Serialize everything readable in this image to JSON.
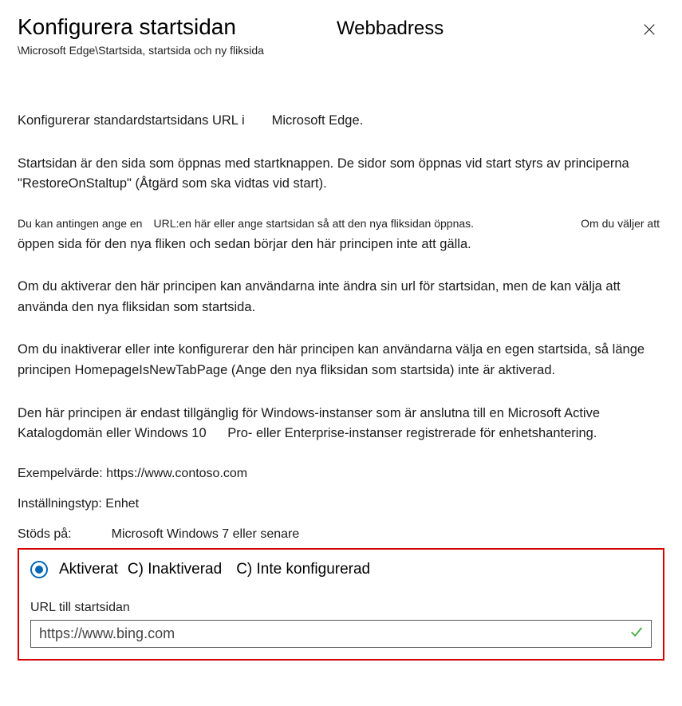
{
  "header": {
    "title": "Konfigurera startsidan",
    "subtitle": "Webbadress",
    "breadcrumb": "\\Microsoft Edge\\Startsida, startsida och ny fliksida"
  },
  "body": {
    "p1_a": "Konfigurerar standardstartsidans URL i",
    "p1_b": "Microsoft Edge.",
    "p2": "Startsidan är den sida som öppnas med startknappen. De sidor som öppnas vid start styrs av principerna \"RestoreOnStaltup\" (Åtgärd som ska vidtas vid start).",
    "p3_small_a": "Du kan antingen ange en",
    "p3_small_b": "URL:en här eller ange startsidan så att den nya fliksidan öppnas.",
    "p3_small_c": "Om du väljer att",
    "p3_line2": "öppen sida för den nya fliken och sedan börjar den här principen inte att gälla.",
    "p4": "Om du aktiverar den här principen kan användarna inte ändra sin url för startsidan, men de kan välja att använda den nya fliksidan som startsida.",
    "p5": "Om du inaktiverar eller inte konfigurerar den här principen kan användarna välja en egen startsida, så länge principen HomepageIsNewTabPage (Ange den nya fliksidan som startsida) inte är aktiverad.",
    "p6_a": "Den här principen är endast tillgänglig för Windows-instanser som är anslutna till en Microsoft Active Katalogdomän eller Windows 10",
    "p6_b": "Pro- eller Enterprise-instanser registrerade för enhetshantering.",
    "example": "Exempelvärde: https://www.contoso.com",
    "setting_type": "Inställningstyp: Enhet",
    "supported_label": "Stöds på:",
    "supported_value": "Microsoft Windows 7 eller senare"
  },
  "config": {
    "opt1": "Aktiverat",
    "opt2": "C) Inaktiverad",
    "opt3": "C) Inte konfigurerad",
    "url_label": "URL till startsidan",
    "url_value": "https://www.bing.com"
  }
}
